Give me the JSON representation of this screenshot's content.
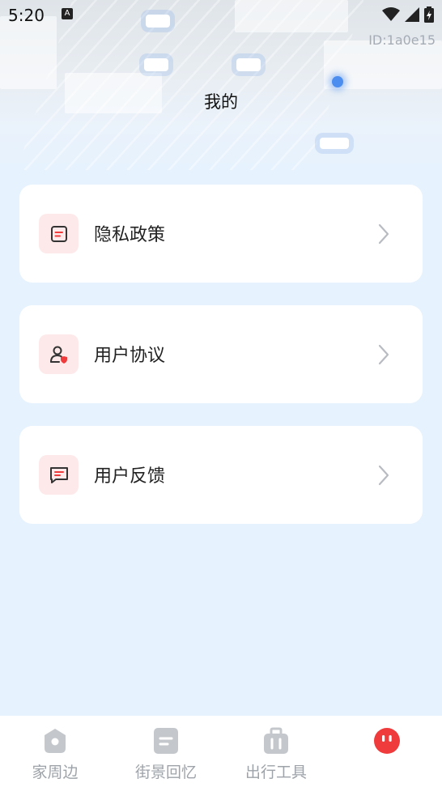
{
  "status_bar": {
    "time": "5:20",
    "notif_glyph": "A"
  },
  "header": {
    "id_text": "ID:1a0e15",
    "title": "我的"
  },
  "menu": [
    {
      "label": "隐私政策",
      "icon": "document-icon"
    },
    {
      "label": "用户协议",
      "icon": "user-shield-icon"
    },
    {
      "label": "用户反馈",
      "icon": "feedback-icon"
    }
  ],
  "tabs": [
    {
      "label": "家周边",
      "icon": "location-pin-icon"
    },
    {
      "label": "街景回忆",
      "icon": "album-icon"
    },
    {
      "label": "出行工具",
      "icon": "suitcase-icon"
    },
    {
      "label": "",
      "icon": "mascot-icon"
    }
  ],
  "colors": {
    "accent_red": "#ef3b3b",
    "icon_bg": "#fde9e9",
    "page_bg": "#e6f2fd",
    "tab_gray": "#c4c8cd"
  }
}
